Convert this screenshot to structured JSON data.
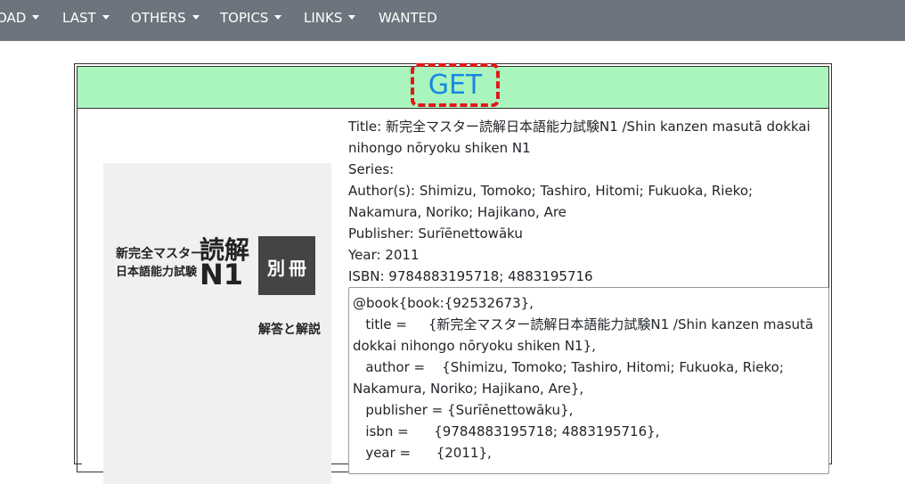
{
  "navbar": {
    "items": [
      {
        "label": "OAD",
        "has_caret": true
      },
      {
        "label": "LAST",
        "has_caret": true
      },
      {
        "label": "OTHERS",
        "has_caret": true
      },
      {
        "label": "TOPICS",
        "has_caret": true
      },
      {
        "label": "LINKS",
        "has_caret": true
      },
      {
        "label": "WANTED",
        "has_caret": false
      }
    ],
    "caret_icon": "chevron-down-icon"
  },
  "get_button": {
    "label": "GET"
  },
  "cover": {
    "series_line": "新完全マスター",
    "subject": "読解",
    "exam_name": "日本語能力試験",
    "level": "N1",
    "supplement": "別冊",
    "answers": "解答と解説"
  },
  "book": {
    "title": "Title: 新完全マスター読解日本語能力試験N1 /Shin kanzen masutā dokkai nihongo nōryoku shiken N1",
    "series": "Series:",
    "authors": "Author(s): Shimizu, Tomoko; Tashiro, Hitomi; Fukuoka, Rieko; Nakamura, Noriko; Hajikano, Are",
    "publisher": "Publisher: Surīēnettowāku",
    "year": "Year: 2011",
    "isbn": "ISBN: 9784883195718; 4883195716"
  },
  "bibtex": "@book{book:{92532673},\n   title =     {新完全マスター読解日本語能力試験N1 /Shin kanzen masutā dokkai nihongo nōryoku shiken N1},\n   author =    {Shimizu, Tomoko; Tashiro, Hitomi; Fukuoka, Rieko; Nakamura, Noriko; Hajikano, Are},\n   publisher = {Surīēnettowāku},\n   isbn =      {9784883195718; 4883195716},\n   year =      {2011},",
  "colors": {
    "navbar": "#6c757d",
    "get_row": "#aaf5bd",
    "get_text": "#1687e6",
    "get_outline": "#e01818"
  }
}
